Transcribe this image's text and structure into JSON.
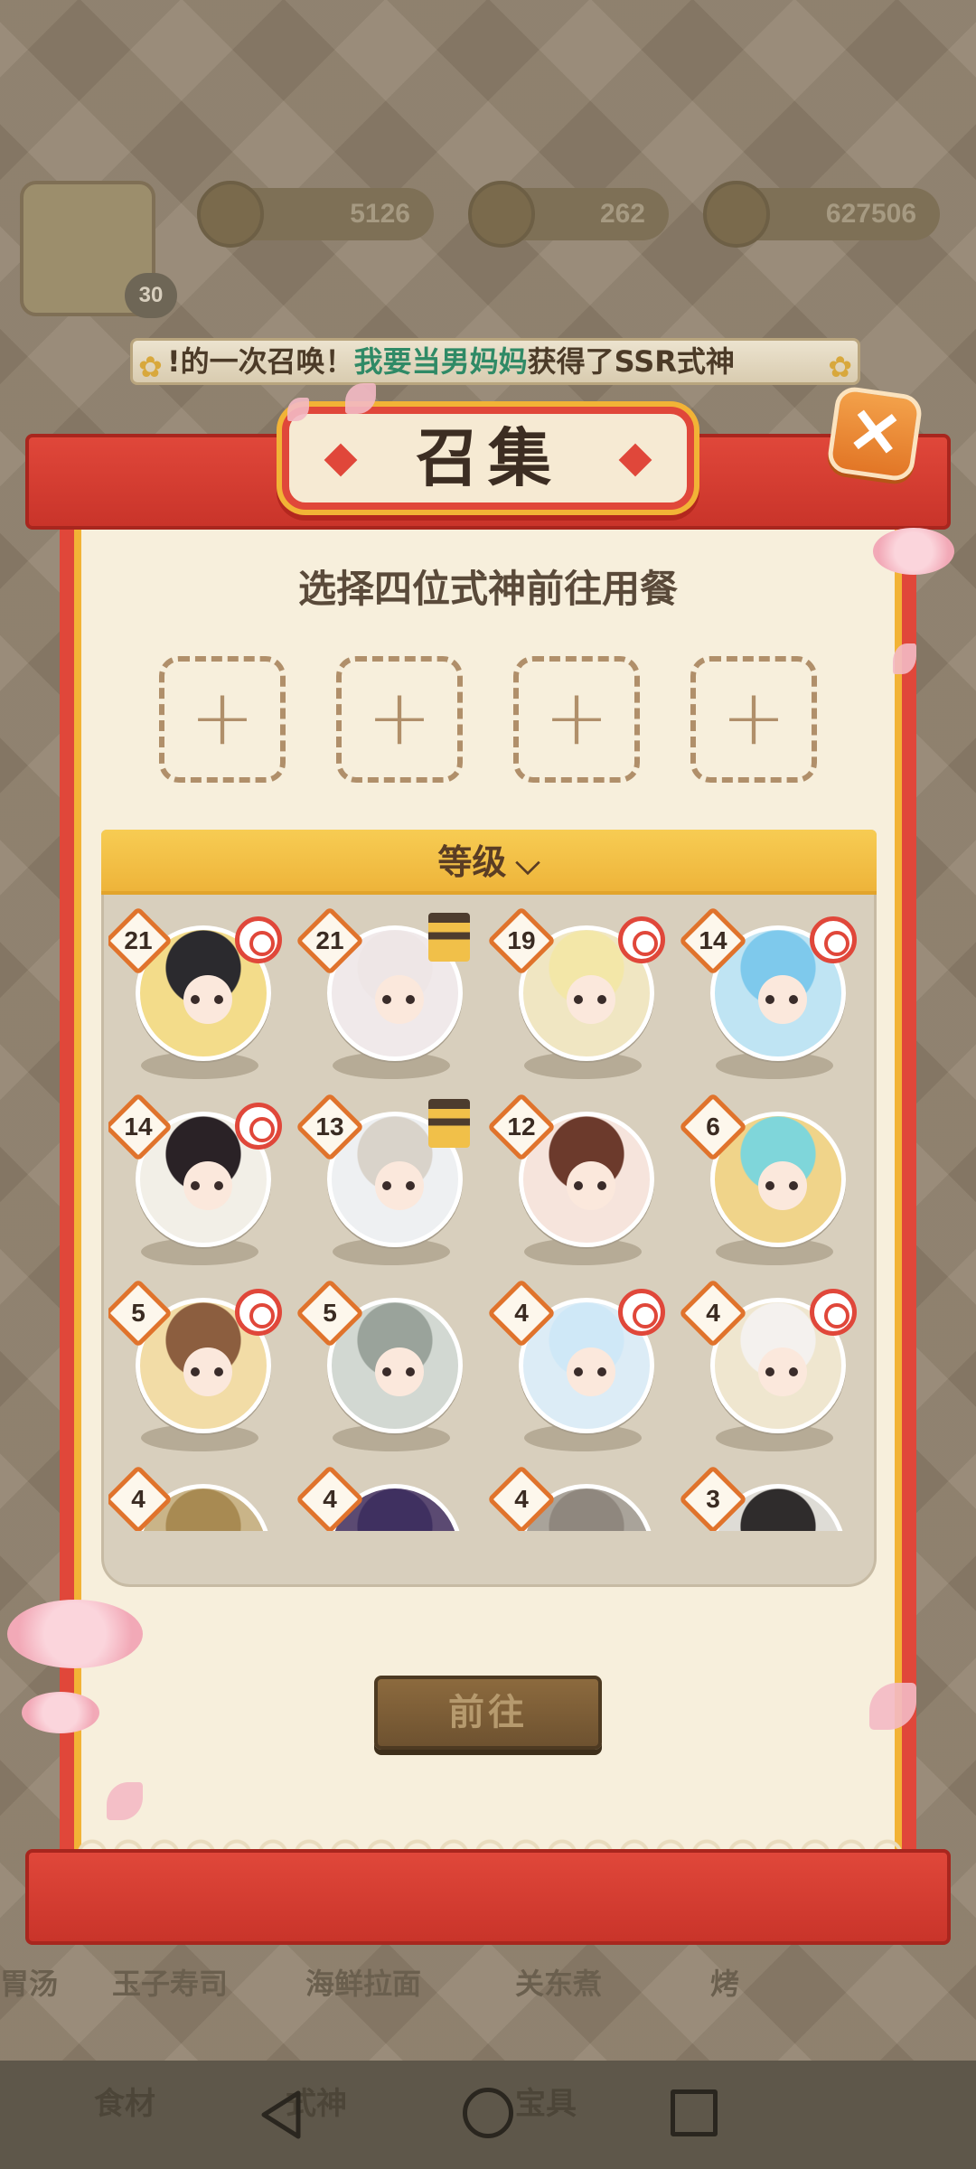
{
  "topbar": {
    "player_level": "30",
    "resources": [
      {
        "name": "plum-blossom",
        "value": "5126"
      },
      {
        "name": "coin-bag",
        "value": "262"
      },
      {
        "name": "gold-coin",
        "value": "627506"
      }
    ]
  },
  "ticker": {
    "prefix": "!的一次召唤！",
    "player_name": "我要当男妈妈",
    "suffix": "获得了SSR式神"
  },
  "modal": {
    "title": "召集",
    "close_label": "✕",
    "subtitle": "选择四位式神前往用餐",
    "slot_label": "+",
    "sort_label": "等级",
    "sort_icon": "⌄",
    "go_label": "前往"
  },
  "shikigami": [
    {
      "level": "21",
      "badge": "skill",
      "bg": "#f3dc8a",
      "hair": "#2b2a2e"
    },
    {
      "level": "21",
      "badge": "tower",
      "bg": "#f0e9ea",
      "hair": "#eee6e6"
    },
    {
      "level": "19",
      "badge": "skill",
      "bg": "#f0e6c2",
      "hair": "#f3e7a8"
    },
    {
      "level": "14",
      "badge": "skill",
      "bg": "#bfe4f3",
      "hair": "#7ec9ec"
    },
    {
      "level": "14",
      "badge": "skill",
      "bg": "#f2efe7",
      "hair": "#2a2226"
    },
    {
      "level": "13",
      "badge": "tower",
      "bg": "#eef0f2",
      "hair": "#d9d3ca"
    },
    {
      "level": "12",
      "badge": "none",
      "bg": "#f6e4dc",
      "hair": "#6c3a2c"
    },
    {
      "level": "6",
      "badge": "none",
      "bg": "#f0d48a",
      "hair": "#7fd6da"
    },
    {
      "level": "5",
      "badge": "skill",
      "bg": "#f2dca6",
      "hair": "#8c5e3f"
    },
    {
      "level": "5",
      "badge": "none",
      "bg": "#d2d8d2",
      "hair": "#9aa39b"
    },
    {
      "level": "4",
      "badge": "skill",
      "bg": "#dcecf6",
      "hair": "#cfe8f7"
    },
    {
      "level": "4",
      "badge": "skill",
      "bg": "#efe6cf",
      "hair": "#f4f1ee"
    },
    {
      "level": "4",
      "badge": "none",
      "bg": "#c9b488",
      "hair": "#a88a52"
    },
    {
      "level": "4",
      "badge": "none",
      "bg": "#5b4a72",
      "hair": "#3f3060"
    },
    {
      "level": "4",
      "badge": "none",
      "bg": "#a9a39a",
      "hair": "#8f877e"
    },
    {
      "level": "3",
      "badge": "none",
      "bg": "#dedcd6",
      "hair": "#2f2c2c"
    }
  ],
  "background_labels": [
    "胃汤",
    "玉子寿司",
    "海鲜拉面",
    "关东煮",
    "烤"
  ],
  "background_tabs": [
    "食材",
    "式神",
    "宝具"
  ],
  "colors": {
    "modal_red": "#e0473a",
    "gold": "#f2b336",
    "paper": "#f7efdc",
    "ticker_highlight": "#2f8a66"
  }
}
